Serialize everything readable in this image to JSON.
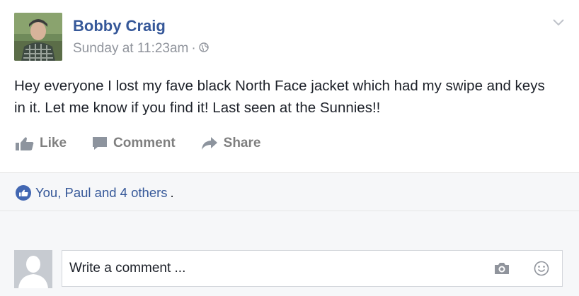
{
  "post": {
    "author": "Bobby Craig",
    "timestamp": "Sunday at 11:23am",
    "separator": "·",
    "privacy_icon": "globe-icon",
    "text": "Hey everyone I lost my fave black North Face jacket which had my swipe and keys in it. Let me know if you find it! Last seen at the Sunnies!!"
  },
  "actions": {
    "like_label": "Like",
    "comment_label": "Comment",
    "share_label": "Share"
  },
  "reactions": {
    "summary": "You, Paul and 4 others",
    "trailing": "."
  },
  "comment_box": {
    "placeholder": "Write a comment ..."
  },
  "colors": {
    "link_blue": "#365899",
    "meta_gray": "#90949c",
    "action_gray": "#7f7f7f",
    "like_badge": "#4267b2",
    "panel_bg": "#f6f7f9"
  }
}
